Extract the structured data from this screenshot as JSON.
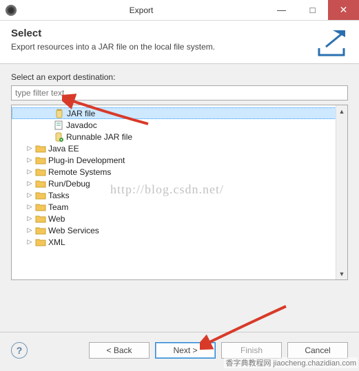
{
  "window": {
    "title": "Export",
    "minimize": "—",
    "maximize": "□",
    "close": "✕"
  },
  "header": {
    "title": "Select",
    "description": "Export resources into a JAR file on the local file system."
  },
  "label_destination": "Select an export destination:",
  "filter_placeholder": "type filter text",
  "tree": {
    "java_children": [
      {
        "label": "JAR file",
        "selected": true,
        "icon": "jar"
      },
      {
        "label": "Javadoc",
        "selected": false,
        "icon": "javadoc"
      },
      {
        "label": "Runnable JAR file",
        "selected": false,
        "icon": "runjar"
      }
    ],
    "folders": [
      "Java EE",
      "Plug-in Development",
      "Remote Systems",
      "Run/Debug",
      "Tasks",
      "Team",
      "Web",
      "Web Services",
      "XML"
    ]
  },
  "buttons": {
    "back": "< Back",
    "next": "Next >",
    "finish": "Finish",
    "cancel": "Cancel"
  },
  "scroll": {
    "up": "▲",
    "down": "▼"
  },
  "toggle_glyph": "▷",
  "help_glyph": "?",
  "watermark_url": "http://blog.csdn.net/",
  "corner_text": "香字典教程网 jiaocheng.chazidian.com"
}
